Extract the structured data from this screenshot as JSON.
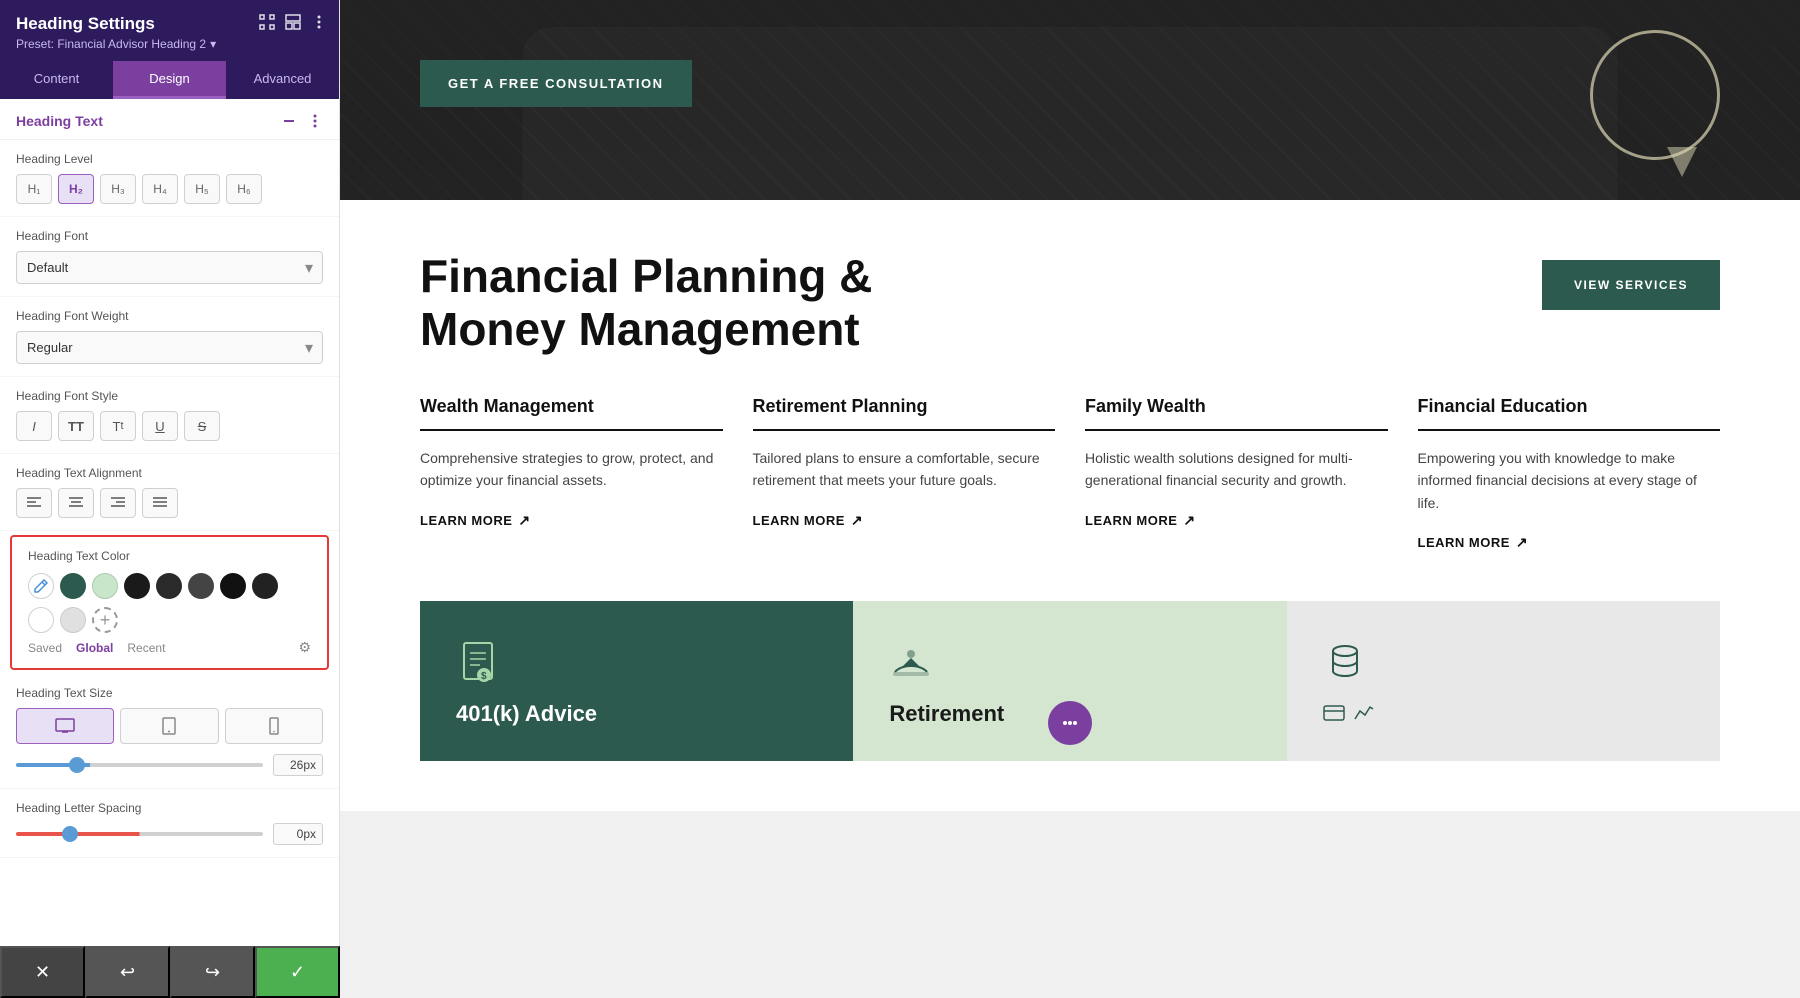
{
  "panel": {
    "title": "Heading Settings",
    "preset": "Preset: Financial Advisor Heading 2",
    "tabs": [
      "Content",
      "Design",
      "Advanced"
    ],
    "active_tab": "Design",
    "section_title": "Heading Text",
    "fields": {
      "heading_level": {
        "label": "Heading Level",
        "options": [
          "H1",
          "H2",
          "H3",
          "H4",
          "H5",
          "H6"
        ],
        "active": "H2"
      },
      "heading_font": {
        "label": "Heading Font",
        "value": "Default"
      },
      "heading_font_weight": {
        "label": "Heading Font Weight",
        "value": "Regular"
      },
      "heading_font_style": {
        "label": "Heading Font Style"
      },
      "heading_text_alignment": {
        "label": "Heading Text Alignment"
      },
      "heading_text_color": {
        "label": "Heading Text Color",
        "swatches": [
          "pencil",
          "#2d5a4e",
          "#c8e6c9",
          "#1a1a1a",
          "#2a2a2a",
          "#3a3a3a",
          "#111111",
          "#222222",
          "#light",
          "#light2"
        ],
        "tabs": [
          "Saved",
          "Global",
          "Recent"
        ],
        "active_tab": "Global"
      },
      "heading_text_size": {
        "label": "Heading Text Size",
        "value": "26px",
        "slider_value": 26
      },
      "heading_letter_spacing": {
        "label": "Heading Letter Spacing",
        "value": "0px",
        "slider_value": 0
      }
    },
    "bottom_actions": {
      "cancel": "✕",
      "undo": "↩",
      "redo": "↪",
      "save": "✓"
    }
  },
  "preview": {
    "hero": {
      "cta_button": "GET A FREE CONSULTATION"
    },
    "main_heading": "Financial Planning & Money Management",
    "view_services_btn": "VIEW SERVICES",
    "services": [
      {
        "title": "Wealth Management",
        "description": "Comprehensive strategies to grow, protect, and optimize your financial assets.",
        "learn_more": "LEARN MORE"
      },
      {
        "title": "Retirement Planning",
        "description": "Tailored plans to ensure a comfortable, secure retirement that meets your future goals.",
        "learn_more": "LEARN MORE"
      },
      {
        "title": "Family Wealth",
        "description": "Holistic wealth solutions designed for multi-generational financial security and growth.",
        "learn_more": "LEARN MORE"
      },
      {
        "title": "Financial Education",
        "description": "Empowering you with knowledge to make informed financial decisions at every stage of life.",
        "learn_more": "LEARN MORE"
      }
    ],
    "bottom_cards": [
      {
        "title": "401(k) Advice",
        "theme": "dark",
        "icon": "document-dollar"
      },
      {
        "title": "Retirement",
        "theme": "light-green",
        "icon": "hand-dollar"
      },
      {
        "title": "",
        "theme": "light-gray",
        "icon": "coins"
      }
    ]
  }
}
